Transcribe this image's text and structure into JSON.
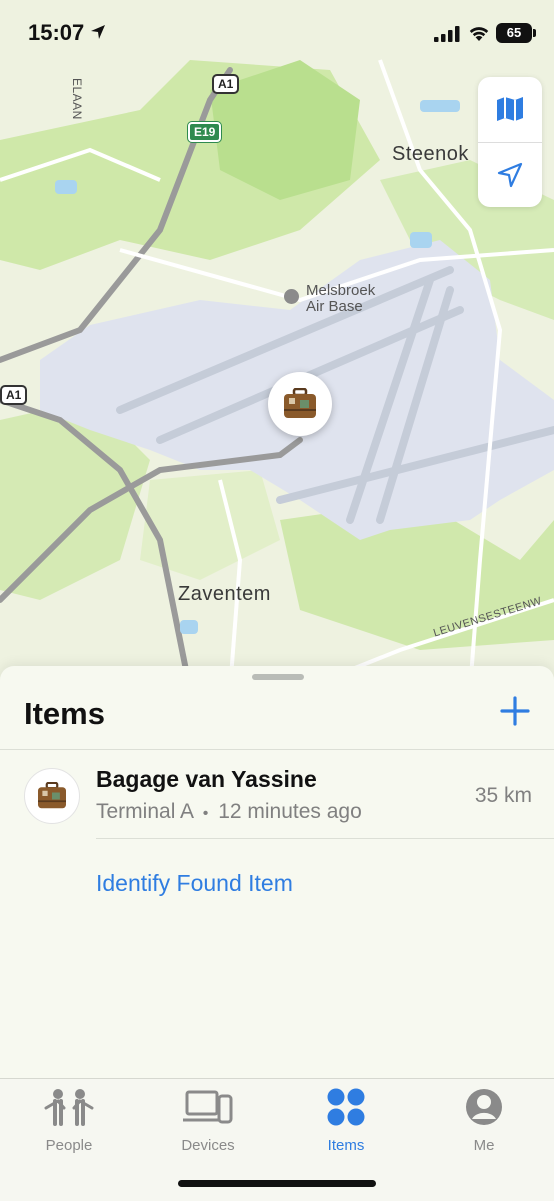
{
  "status_bar": {
    "time": "15:07",
    "battery": "65"
  },
  "map": {
    "labels": {
      "steenok": "Steenok",
      "melsbroek_line1": "Melsbroek",
      "melsbroek_line2": "Air Base",
      "zaventem": "Zaventem",
      "leuvensesteenweg": "LEUVENSESTEENW",
      "elaan": "ELAAN"
    },
    "shields": {
      "a1_top": "A1",
      "e19": "E19",
      "a1_left": "A1"
    },
    "controls": {
      "map_mode_icon": "map-icon",
      "location_icon": "location-arrow-icon"
    }
  },
  "sheet": {
    "title": "Items",
    "add_icon": "plus-icon",
    "items": [
      {
        "name": "Bagage van Yassine",
        "location": "Terminal A",
        "separator": "•",
        "time": "12 minutes ago",
        "distance": "35 km",
        "icon": "suitcase-icon"
      }
    ],
    "identify_link": "Identify Found Item"
  },
  "tabs": [
    {
      "label": "People",
      "icon": "people-icon",
      "active": false
    },
    {
      "label": "Devices",
      "icon": "devices-icon",
      "active": false
    },
    {
      "label": "Items",
      "icon": "items-icon",
      "active": true
    },
    {
      "label": "Me",
      "icon": "person-icon",
      "active": false
    }
  ],
  "colors": {
    "accent": "#2f7de1",
    "airport": "#dfe3ee",
    "park": "#cde8a8",
    "land": "#eef2e0"
  }
}
